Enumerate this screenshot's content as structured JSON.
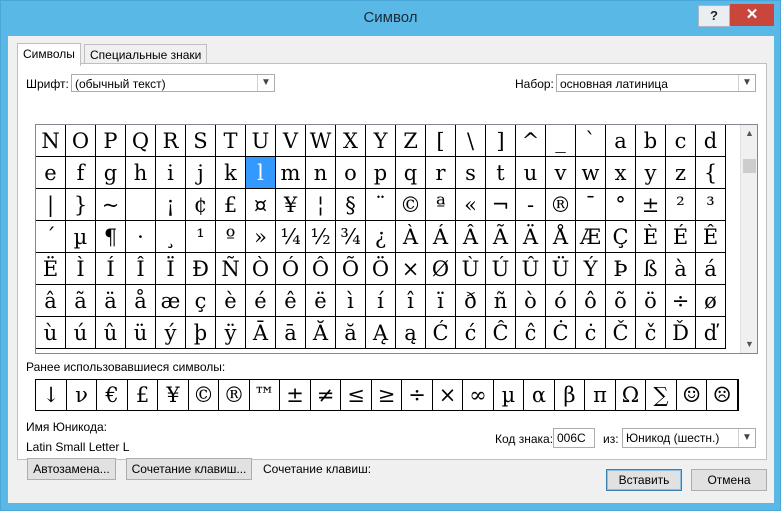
{
  "window": {
    "title": "Символ",
    "help": "?",
    "close": "✕"
  },
  "tabs": [
    {
      "label": "Символы"
    },
    {
      "label": "Специальные знаки"
    }
  ],
  "font": {
    "label": "Шрифт:",
    "value": "(обычный текст)"
  },
  "subset": {
    "label": "Набор:",
    "value": "основная латиница"
  },
  "grid": [
    [
      "N",
      "O",
      "P",
      "Q",
      "R",
      "S",
      "T",
      "U",
      "V",
      "W",
      "X",
      "Y",
      "Z",
      "[",
      "\\",
      "]",
      "^",
      "_",
      "`",
      "a",
      "b",
      "c",
      "d"
    ],
    [
      "e",
      "f",
      "g",
      "h",
      "i",
      "j",
      "k",
      "l",
      "m",
      "n",
      "o",
      "p",
      "q",
      "r",
      "s",
      "t",
      "u",
      "v",
      "w",
      "x",
      "y",
      "z",
      "{"
    ],
    [
      "|",
      "}",
      "~",
      " ",
      "¡",
      "¢",
      "£",
      "¤",
      "¥",
      "¦",
      "§",
      "¨",
      "©",
      "ª",
      "«",
      "¬",
      "-",
      "®",
      "¯",
      "°",
      "±",
      "²",
      "³"
    ],
    [
      "´",
      "µ",
      "¶",
      "·",
      "¸",
      "¹",
      "º",
      "»",
      "¼",
      "½",
      "¾",
      "¿",
      "À",
      "Á",
      "Â",
      "Ã",
      "Ä",
      "Å",
      "Æ",
      "Ç",
      "È",
      "É",
      "Ê"
    ],
    [
      "Ë",
      "Ì",
      "Í",
      "Î",
      "Ï",
      "Ð",
      "Ñ",
      "Ò",
      "Ó",
      "Ô",
      "Õ",
      "Ö",
      "×",
      "Ø",
      "Ù",
      "Ú",
      "Û",
      "Ü",
      "Ý",
      "Þ",
      "ß",
      "à",
      "á"
    ],
    [
      "â",
      "ã",
      "ä",
      "å",
      "æ",
      "ç",
      "è",
      "é",
      "ê",
      "ë",
      "ì",
      "í",
      "î",
      "ï",
      "ð",
      "ñ",
      "ò",
      "ó",
      "ô",
      "õ",
      "ö",
      "÷",
      "ø"
    ],
    [
      "ù",
      "ú",
      "û",
      "ü",
      "ý",
      "þ",
      "ÿ",
      "Ā",
      "ā",
      "Ă",
      "ă",
      "Ą",
      "ą",
      "Ć",
      "ć",
      "Ĉ",
      "ĉ",
      "Ċ",
      "ċ",
      "Č",
      "č",
      "Ď",
      "ď"
    ]
  ],
  "selected": {
    "row": 1,
    "col": 7
  },
  "recent": {
    "label": "Ранее использовавшиеся символы:",
    "items": [
      "↓",
      "ν",
      "€",
      "£",
      "¥",
      "©",
      "®",
      "™",
      "±",
      "≠",
      "≤",
      "≥",
      "÷",
      "×",
      "∞",
      "µ",
      "α",
      "β",
      "π",
      "Ω",
      "∑",
      "☺",
      "☹"
    ]
  },
  "unicode_name": {
    "label": "Имя Юникода:",
    "value": "Latin Small Letter L"
  },
  "char_code": {
    "label": "Код знака:",
    "value": "006C"
  },
  "from": {
    "label": "из:",
    "value": "Юникод (шестн.)"
  },
  "buttons": {
    "autocorrect": "Автозамена...",
    "shortcut_key": "Сочетание клавиш...",
    "insert": "Вставить",
    "cancel": "Отмена"
  },
  "shortcut_label": "Сочетание клавиш:"
}
